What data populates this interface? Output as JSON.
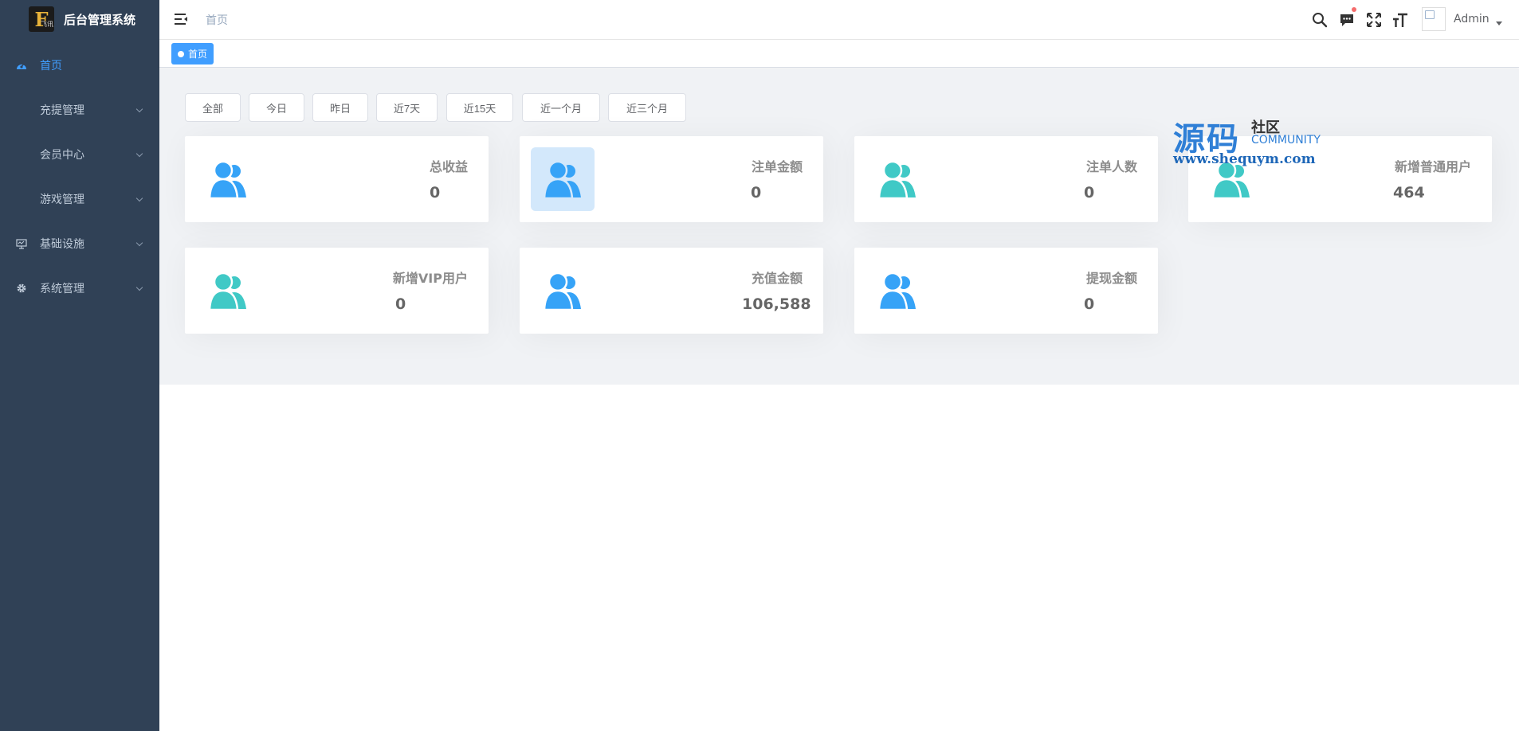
{
  "sidebar": {
    "brand_logo_text": "F",
    "brand_logo_sub": "飞讯",
    "brand_title": "后台管理系统",
    "items": [
      {
        "label": "首页",
        "icon": "dashboard-icon"
      },
      {
        "label": "充提管理",
        "icon": ""
      },
      {
        "label": "会员中心",
        "icon": ""
      },
      {
        "label": "游戏管理",
        "icon": ""
      },
      {
        "label": "基础设施",
        "icon": "monitor-icon"
      },
      {
        "label": "系统管理",
        "icon": "gear-icon"
      }
    ]
  },
  "header": {
    "breadcrumb": "首页",
    "user_name": "Admin",
    "icons": [
      "hamburger-icon",
      "search-icon",
      "message-icon",
      "fullscreen-icon",
      "font-size-icon",
      "avatar"
    ]
  },
  "tags": {
    "active": "首页"
  },
  "filters": [
    "全部",
    "今日",
    "昨日",
    "近7天",
    "近15天",
    "近一个月",
    "近三个月"
  ],
  "cards": [
    {
      "label": "总收益",
      "value": "0",
      "icon_color": "#36a3f7"
    },
    {
      "label": "注单金额",
      "value": "0",
      "icon_color": "#36a3f7"
    },
    {
      "label": "注单人数",
      "value": "0",
      "icon_color": "#40c9c6"
    },
    {
      "label": "新增普通用户",
      "value": "464",
      "icon_color": "#40c9c6"
    },
    {
      "label": "新增VIP用户",
      "value": "0",
      "icon_color": "#40c9c6"
    },
    {
      "label": "充值金额",
      "value": "106,588",
      "icon_color": "#36a3f7"
    },
    {
      "label": "提现金额",
      "value": "0",
      "icon_color": "#36a3f7"
    }
  ],
  "watermark": {
    "big": "源码",
    "small_cn": "社区",
    "small_en": "COMMUNITY",
    "url": "www.shequym.com"
  },
  "colors": {
    "sidebar_bg": "#304156",
    "accent": "#409eff",
    "content_bg": "#f0f2f5"
  }
}
